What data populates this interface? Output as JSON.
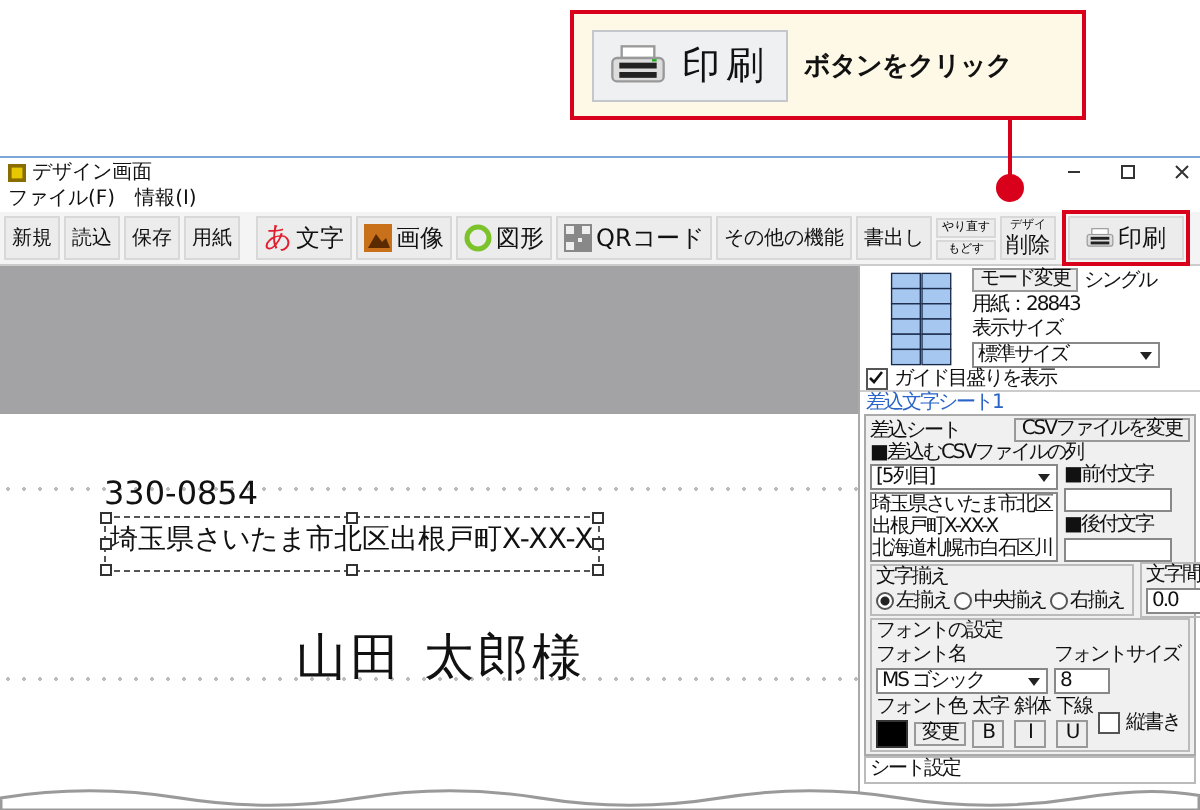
{
  "callout": {
    "button_label": "印刷",
    "text": "ボタンをクリック"
  },
  "window": {
    "title": "デザイン画面"
  },
  "menu": [
    "ファイル(F)",
    "情報(I)"
  ],
  "toolbar": [
    {
      "kind": "plain",
      "label": "新規",
      "highlighted": false
    },
    {
      "kind": "plain",
      "label": "読込",
      "highlighted": false
    },
    {
      "kind": "plain",
      "label": "保存",
      "highlighted": false
    },
    {
      "kind": "plain",
      "label": "用紙",
      "highlighted": false
    },
    {
      "kind": "glyph",
      "glyph": "あ",
      "label": "文字",
      "highlighted": false
    },
    {
      "kind": "picture",
      "label": "画像",
      "highlighted": false
    },
    {
      "kind": "ring",
      "label": "図形",
      "highlighted": false
    },
    {
      "kind": "qr",
      "label": "QRコード",
      "highlighted": false
    },
    {
      "kind": "plain",
      "label": "その他の機能",
      "highlighted": false
    },
    {
      "kind": "plain",
      "label": "書出し",
      "highlighted": false
    },
    {
      "kind": "stacked",
      "top": "やり直す",
      "bottom": "もどす",
      "highlighted": false
    },
    {
      "kind": "split",
      "top": "デザイ",
      "bottom": "削除",
      "highlighted": false
    },
    {
      "kind": "printer",
      "label": "印刷",
      "highlighted": true
    }
  ],
  "canvas": {
    "postal_code": "330-0854",
    "address": "埼玉県さいたま市北区出根戸町X-XX-X",
    "address_selected": true,
    "name": "山田 太郎様"
  },
  "side_panel": {
    "mode_button": "モード変更",
    "mode": "シングル",
    "paper": "用紙：28843",
    "display_size_label": "表示サイズ",
    "display_size": "標準サイズ",
    "guide": {
      "label": "ガイド目盛りを表示",
      "checked": true
    },
    "tab": "差込文字シート1",
    "sheet_group": "差込シート",
    "csv_button": "CSVファイルを変更",
    "column_label": "■差込むCSVファイルの列",
    "column": "[5列目]",
    "preview_lines": [
      "埼玉県さいたま市北区",
      "出根戸町X-XX-X",
      "北海道札幌市白石区川"
    ],
    "prefix_label": "■前付文字",
    "suffix_label": "■後付文字",
    "align_group": "文字揃え",
    "align_options": [
      {
        "label": "左揃え",
        "selected": true
      },
      {
        "label": "中央揃え",
        "selected": false
      },
      {
        "label": "右揃え",
        "selected": false
      }
    ],
    "spacing_label": "文字間",
    "spacing": "0.0",
    "font_group": "フォントの設定",
    "font_name_label": "フォント名",
    "font_name": "MS ゴシック",
    "font_size_label": "フォントサイズ",
    "font_size": "8",
    "font_color_label": "フォント色",
    "change_button": "変更",
    "styles": [
      {
        "label": "太字",
        "key": "B"
      },
      {
        "label": "斜体",
        "key": "I"
      },
      {
        "label": "下線",
        "key": "U"
      }
    ],
    "vertical": {
      "label": "縦書き",
      "checked": false
    },
    "sheet_settings": "シート設定"
  }
}
